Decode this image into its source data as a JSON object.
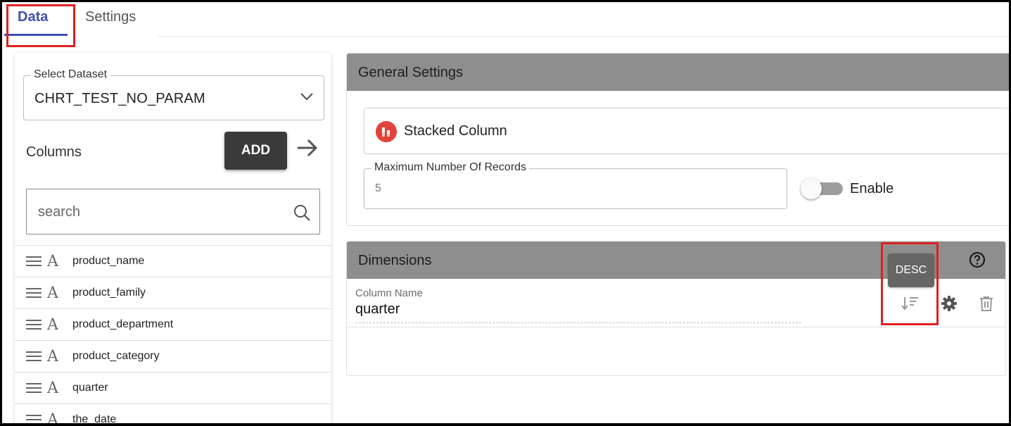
{
  "tabs": [
    {
      "label": "Data",
      "active": true
    },
    {
      "label": "Settings",
      "active": false
    }
  ],
  "left_panel": {
    "dataset": {
      "legend": "Select Dataset",
      "value": "CHRT_TEST_NO_PARAM"
    },
    "columns_label": "Columns",
    "add_button": "ADD",
    "search": {
      "placeholder": "search"
    },
    "columns": [
      {
        "name": "product_name",
        "type_icon": "A"
      },
      {
        "name": "product_family",
        "type_icon": "A"
      },
      {
        "name": "product_department",
        "type_icon": "A"
      },
      {
        "name": "product_category",
        "type_icon": "A"
      },
      {
        "name": "quarter",
        "type_icon": "A"
      },
      {
        "name": "the_date",
        "type_icon": "A"
      }
    ]
  },
  "general_settings": {
    "title": "General Settings",
    "chart_type": "Stacked Column",
    "max_records": {
      "legend": "Maximum Number Of Records",
      "value": "5"
    },
    "toggle": {
      "label": "Enable",
      "on": false
    }
  },
  "dimensions": {
    "title": "Dimensions",
    "field_label": "Column Name",
    "field_value": "quarter",
    "tooltip": "DESC"
  },
  "colors": {
    "accent": "#3f51b5",
    "panel_header": "#8e8e8e",
    "highlight": "#e02020",
    "chart_icon": "#e0433a"
  },
  "icons": [
    "chevron-down-icon",
    "arrow-right-icon",
    "search-icon",
    "drag-handle-icon",
    "text-type-icon",
    "stacked-column-icon",
    "help-icon",
    "sort-desc-icon",
    "gear-icon",
    "trash-icon"
  ]
}
